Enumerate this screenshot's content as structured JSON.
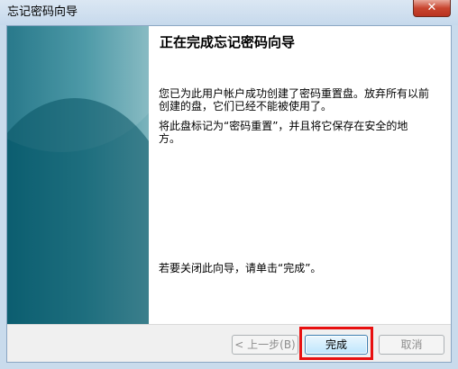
{
  "window": {
    "title": "忘记密码向导",
    "close_label": "✕"
  },
  "content": {
    "heading": "正在完成忘记密码向导",
    "paragraph1": "您已为此用户帐户成功创建了密码重置盘。放弃所有以前创建的盘，它们已经不能被使用了。",
    "paragraph2": "将此盘标记为“密码重置”，并且将它保存在安全的地方。",
    "paragraph3": "若要关闭此向导，请单击“完成”。"
  },
  "buttons": {
    "back": "< 上一步(B)",
    "finish": "完成",
    "cancel": "取消"
  },
  "colors": {
    "highlight": "#e81010",
    "banner": "#116a7e",
    "titlebar": "#c6d9ec"
  }
}
